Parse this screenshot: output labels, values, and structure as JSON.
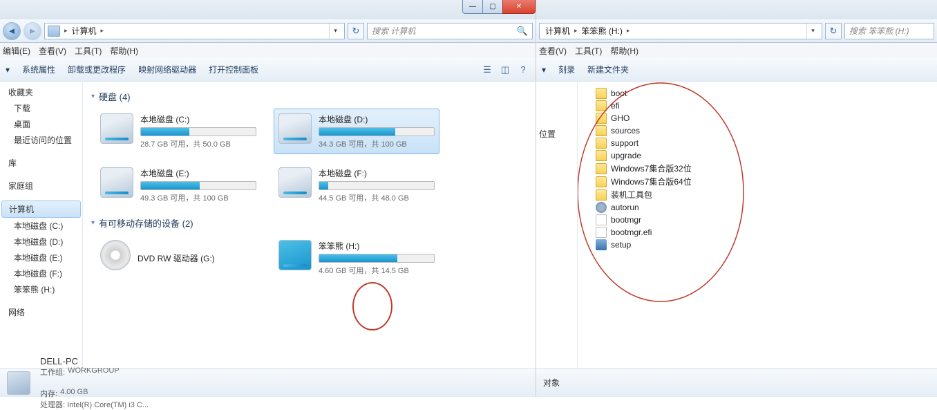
{
  "left": {
    "breadcrumbs": [
      "计算机"
    ],
    "search_placeholder": "搜索 计算机",
    "menubar": [
      "编辑(E)",
      "查看(V)",
      "工具(T)",
      "帮助(H)"
    ],
    "toolbar": [
      "系统属性",
      "卸载或更改程序",
      "映射网络驱动器",
      "打开控制面板"
    ],
    "sidebar": {
      "favorites": {
        "title": "收藏夹",
        "items": [
          "下载",
          "桌面",
          "最近访问的位置"
        ]
      },
      "libraries": {
        "title": "库"
      },
      "homegroup": {
        "title": "家庭组"
      },
      "computer": {
        "title": "计算机",
        "items": [
          "本地磁盘 (C:)",
          "本地磁盘 (D:)",
          "本地磁盘 (E:)",
          "本地磁盘 (F:)",
          "笨笨熊 (H:)"
        ]
      },
      "network": {
        "title": "网络"
      }
    },
    "sections": {
      "hdd": {
        "title": "硬盘 (4)"
      },
      "removable": {
        "title": "有可移动存储的设备 (2)"
      }
    },
    "drives": [
      {
        "name": "本地磁盘 (C:)",
        "stats": "28.7 GB 可用，共 50.0 GB",
        "fill": 42
      },
      {
        "name": "本地磁盘 (D:)",
        "stats": "34.3 GB 可用，共 100 GB",
        "fill": 66,
        "selected": true
      },
      {
        "name": "本地磁盘 (E:)",
        "stats": "49.3 GB 可用，共 100 GB",
        "fill": 51
      },
      {
        "name": "本地磁盘 (F:)",
        "stats": "44.5 GB 可用，共 48.0 GB",
        "fill": 8
      }
    ],
    "removable": [
      {
        "name": "DVD RW 驱动器 (G:)",
        "type": "dvd"
      },
      {
        "name": "笨笨熊 (H:)",
        "type": "pkg",
        "stats": "4.60 GB 可用，共 14.5 GB",
        "fill": 68
      }
    ],
    "status": {
      "name": "DELL-PC",
      "workgroup_label": "工作组:",
      "workgroup": "WORKGROUP",
      "mem_label": "内存:",
      "mem": "4.00 GB",
      "cpu_label": "处理器:",
      "cpu": "Intel(R) Core(TM) i3 C..."
    }
  },
  "right": {
    "breadcrumbs": [
      "计算机",
      "笨笨熊 (H:)"
    ],
    "search_placeholder": "搜索 笨笨熊 (H:)",
    "menubar": [
      "查看(V)",
      "工具(T)",
      "帮助(H)"
    ],
    "toolbar": [
      "刻录",
      "新建文件夹"
    ],
    "sidebar_fragment": "位置",
    "files": [
      {
        "name": "boot",
        "type": "folder"
      },
      {
        "name": "efi",
        "type": "folder"
      },
      {
        "name": "GHO",
        "type": "folder"
      },
      {
        "name": "sources",
        "type": "folder"
      },
      {
        "name": "support",
        "type": "folder"
      },
      {
        "name": "upgrade",
        "type": "folder"
      },
      {
        "name": "Windows7集合版32位",
        "type": "folder"
      },
      {
        "name": "Windows7集合版64位",
        "type": "folder"
      },
      {
        "name": "装机工具包",
        "type": "folder"
      },
      {
        "name": "autorun",
        "type": "gear"
      },
      {
        "name": "bootmgr",
        "type": "plain"
      },
      {
        "name": "bootmgr.efi",
        "type": "plain"
      },
      {
        "name": "setup",
        "type": "exe"
      }
    ],
    "status_fragment": "对象"
  }
}
